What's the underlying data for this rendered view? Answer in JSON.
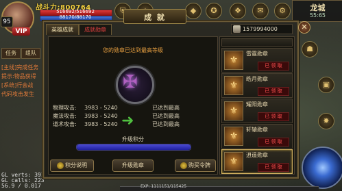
{
  "hud": {
    "level": "95",
    "vip": "VIP",
    "power": "战斗力:800764",
    "hp_text": "516692/516692",
    "hp_fraction": 1.0,
    "mp_text": "88170/88170",
    "mp_fraction": 1.0
  },
  "city": {
    "name": "龙城",
    "time": "55:65"
  },
  "left_tabs": [
    "任务",
    "组队"
  ],
  "chat": [
    "[主线]完成任务",
    "提示:物品获得",
    "[系统]行会战",
    "代码攻击发生"
  ],
  "debug": {
    "line1": "GL verts: 3914",
    "line2": "GL calls: 223",
    "line3": "56.9 / 0.017"
  },
  "bottom_exp": "EXP: 1111151/115425",
  "dialog": {
    "title": "成 就",
    "close": "✕",
    "tabs": {
      "hero": "英雄成就",
      "medal": "成就勋章"
    },
    "currency": "1579994000",
    "message": "您的勋章已达到最高等级",
    "stats": [
      {
        "name": "物理攻击:",
        "value": "3983 - 5240",
        "max": "已达到最高"
      },
      {
        "name": "魔法攻击:",
        "value": "3983 - 5240",
        "max": "已达到最高"
      },
      {
        "name": "道术攻击:",
        "value": "3983 - 5240",
        "max": "已达到最高"
      }
    ],
    "exp_label": "升级积分",
    "exp_fraction": 1.0,
    "buttons": {
      "explain": "积分说明",
      "upgrade": "升级勋章",
      "buy": "购买令牌"
    }
  },
  "medals": [
    {
      "name": "雷霆勋章",
      "status": "已 领 取"
    },
    {
      "name": "皓月勋章",
      "status": "已 领 取"
    },
    {
      "name": "耀阳勋章",
      "status": "已 领 取"
    },
    {
      "name": "轩辕勋章",
      "status": "已 领 取"
    },
    {
      "name": "逍遥勋章",
      "status": "已 领 取"
    }
  ]
}
